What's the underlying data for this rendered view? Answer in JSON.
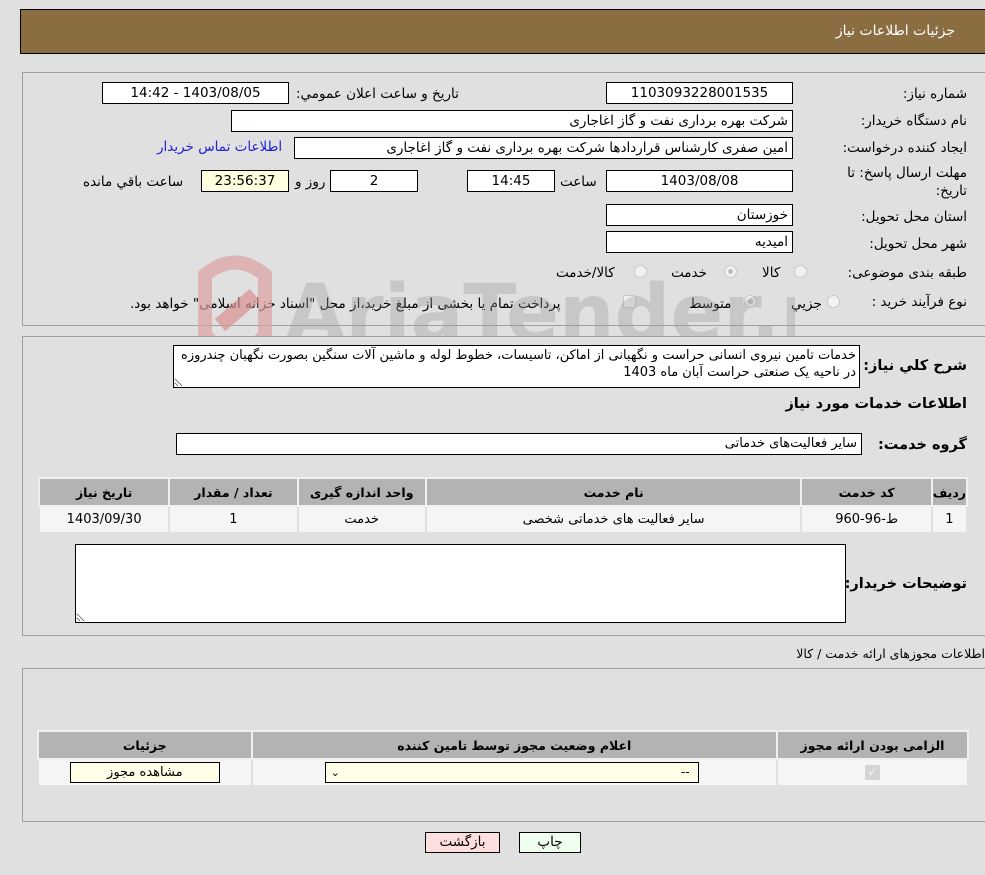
{
  "header": {
    "title": "جزئیات اطلاعات نیاز"
  },
  "details": {
    "need_number_label": "شماره نیاز:",
    "need_number": "1103093228001535",
    "announce_label": "تاريخ و ساعت اعلان عمومي:",
    "announce_value": "1403/08/05 - 14:42",
    "buyer_org_label": "نام دستگاه خريدار:",
    "buyer_org": "شرکت بهره برداری نفت و گاز اغاجاری",
    "creator_label": "ايجاد کننده درخواست:",
    "creator": "امین صفری کارشناس قراردادها شرکت بهره برداری نفت و گاز اغاجاری",
    "contact_link": "اطلاعات تماس خريدار",
    "deadline_label": "مهلت ارسال پاسخ: تا تاريخ:",
    "deadline_date": "1403/08/08",
    "time_label": "ساعت",
    "deadline_time": "14:45",
    "days_value": "2",
    "days_label": "روز و",
    "remaining_time": "23:56:37",
    "remaining_label": "ساعت باقي مانده",
    "province_label": "استان محل تحويل:",
    "province": "خوزستان",
    "city_label": "شهر محل تحويل:",
    "city": "امیدیه",
    "category_label": "طبقه بندی موضوعی:",
    "category_options": [
      {
        "label": "کالا",
        "selected": false
      },
      {
        "label": "خدمت",
        "selected": true
      },
      {
        "label": "کالا/خدمت",
        "selected": false
      }
    ],
    "process_label": "نوع فرآيند خريد :",
    "process_options": [
      {
        "label": "جزيي",
        "selected": false
      },
      {
        "label": "متوسط",
        "selected": true
      }
    ],
    "treasury_note": "پرداخت تمام يا بخشی از مبلغ خريد،از محل \"اسناد خزانه اسلامی\" خواهد بود.",
    "treasury_checked": false
  },
  "description": {
    "label": "شرح کلي نياز:",
    "text": "خدمات تامین نیروی انسانی حراست و نگهبانی از اماکن، تاسیسات، خطوط لوله و ماشین آلات سنگین بصورت نگهبان چندروزه در ناحیه یک صنعتی حراست آبان ماه 1403"
  },
  "services": {
    "section_title": "اطلاعات خدمات مورد نياز",
    "group_label": "گروه خدمت:",
    "group_value": "ساير فعاليت‌های خدماتی",
    "columns": [
      "رديف",
      "کد خدمت",
      "نام خدمت",
      "واحد اندازه گيری",
      "تعداد / مقدار",
      "تاريخ نياز"
    ],
    "rows": [
      [
        "1",
        "ط-96-960",
        "ساير فعاليت های خدماتی شخصی",
        "خدمت",
        "1",
        "1403/09/30"
      ]
    ],
    "buyer_notes_label": "توضيحات خريدار:",
    "buyer_notes": ""
  },
  "permits": {
    "section_title": "اطلاعات مجوزهای ارائه خدمت / کالا",
    "columns": [
      "الزامی بودن ارائه مجوز",
      "اعلام وضعيت مجوز توسط تامين کننده",
      "جزئيات"
    ],
    "rows": [
      {
        "required": true,
        "status": "--",
        "details_button": "مشاهده مجوز"
      }
    ]
  },
  "actions": {
    "print": "چاپ",
    "back": "بازگشت"
  },
  "watermark": {
    "text": "AriaTender.neT"
  }
}
